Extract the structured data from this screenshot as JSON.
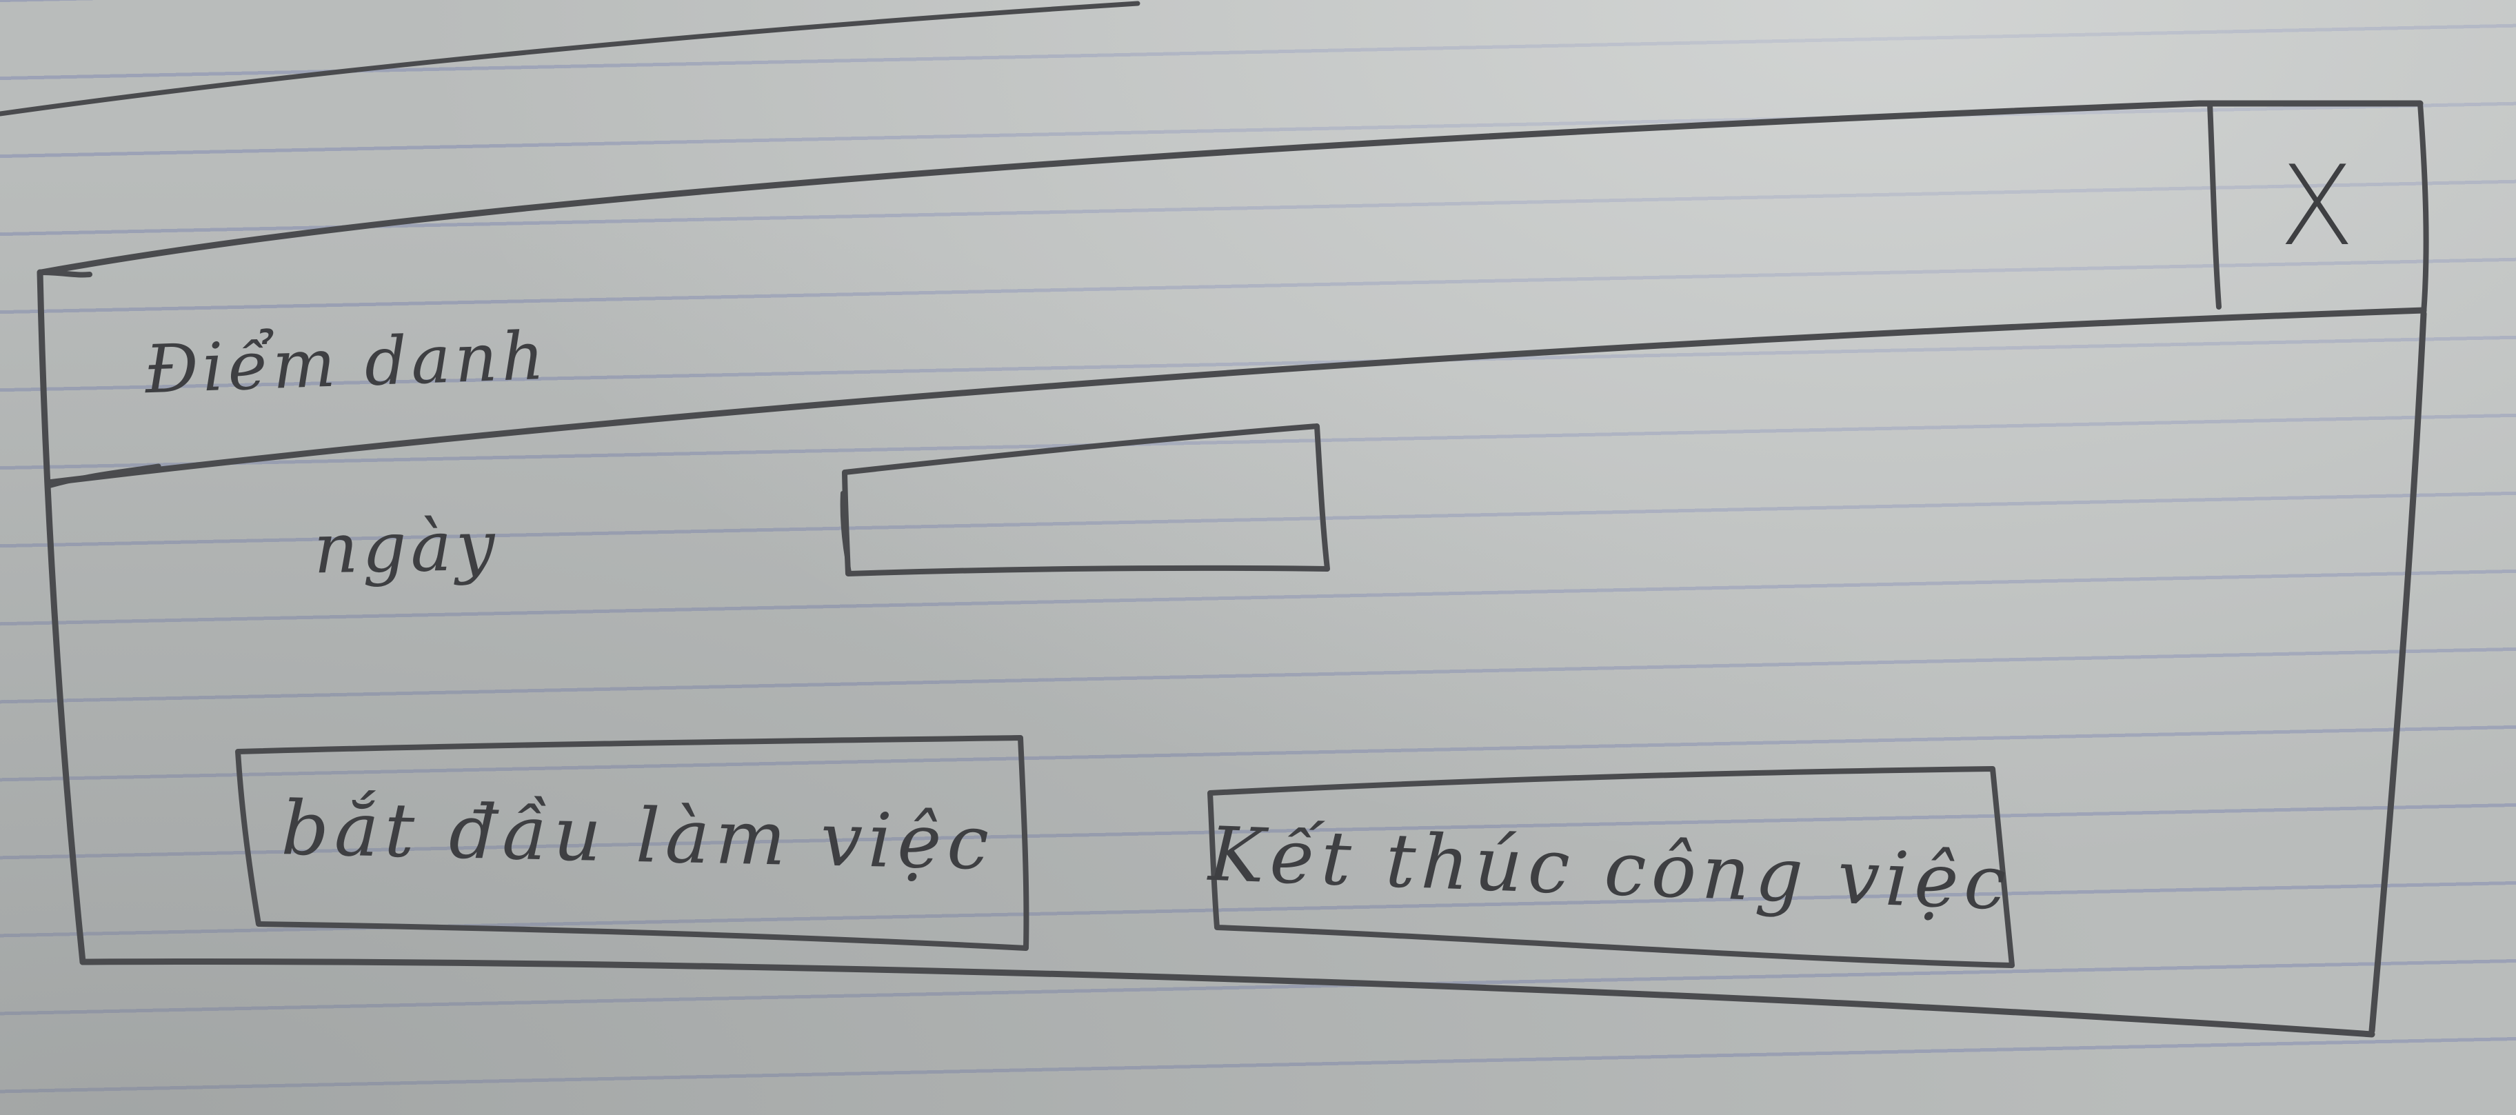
{
  "window": {
    "close_label": "X"
  },
  "dialog": {
    "title": "Điểm danh"
  },
  "form": {
    "date_label": "ngày",
    "date_value": ""
  },
  "buttons": {
    "start_label": "bắt đầu làm việc",
    "end_label": "Kết thúc công việc"
  }
}
